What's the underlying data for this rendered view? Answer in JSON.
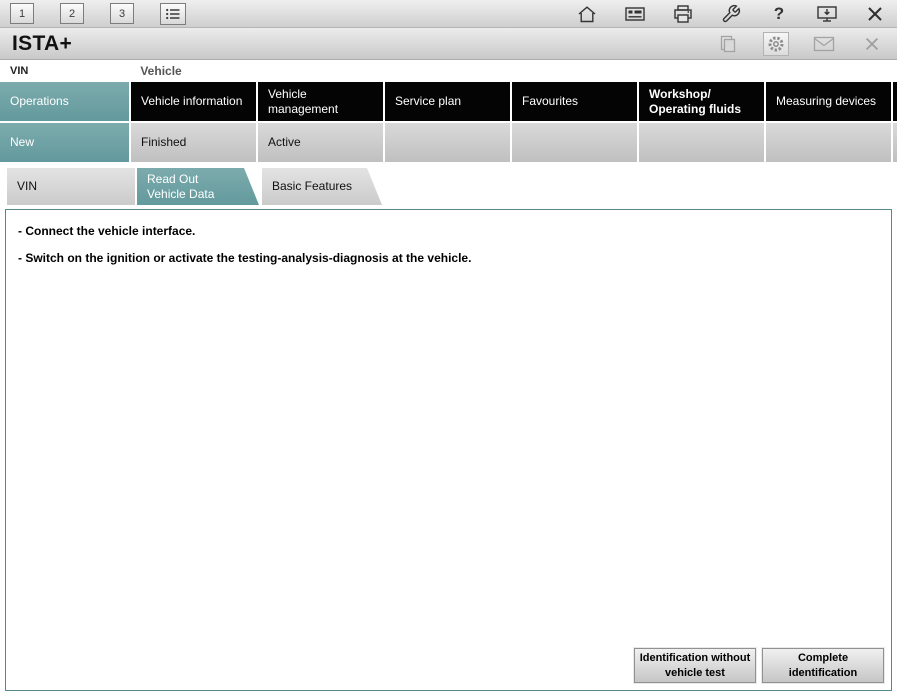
{
  "toolbar": {
    "page_buttons": [
      "1",
      "2",
      "3"
    ],
    "help_glyph": "?"
  },
  "titlebar": {
    "title": "ISTA+"
  },
  "context_bar": {
    "vin_label": "VIN",
    "vehicle_label": "Vehicle"
  },
  "nav_tabs": [
    {
      "label": "Operations",
      "active": true
    },
    {
      "label": "Vehicle information",
      "active": false
    },
    {
      "label": "Vehicle\nmanagement",
      "active": false
    },
    {
      "label": "Service plan",
      "active": false
    },
    {
      "label": "Favourites",
      "active": false
    },
    {
      "label": "Workshop/\nOperating fluids",
      "active": false
    },
    {
      "label": "Measuring devices",
      "active": false
    }
  ],
  "sub_tabs": [
    {
      "label": "New",
      "active": true
    },
    {
      "label": "Finished",
      "active": false
    },
    {
      "label": "Active",
      "active": false
    },
    {
      "label": "",
      "active": false
    },
    {
      "label": "",
      "active": false
    },
    {
      "label": "",
      "active": false
    },
    {
      "label": "",
      "active": false
    }
  ],
  "breadcrumb_tabs": [
    {
      "label": "VIN",
      "active": false
    },
    {
      "label": "Read Out\nVehicle Data",
      "active": true
    },
    {
      "label": "Basic Features",
      "active": false
    }
  ],
  "content": {
    "instructions": [
      "- Connect the vehicle interface.",
      "- Switch on the ignition or activate the testing-analysis-diagnosis at the vehicle."
    ]
  },
  "footer": {
    "buttons": [
      "Identification without vehicle test",
      "Complete identification"
    ]
  },
  "colors": {
    "accent_teal": "#6b9e9f",
    "tab_black": "#040404",
    "content_border": "#54888b"
  },
  "icons": {
    "toolbar_left": [
      "list-icon"
    ],
    "toolbar_right": [
      "home-icon",
      "screen-keyboard-icon",
      "printer-icon",
      "wrench-icon",
      "help-icon",
      "monitor-icon",
      "close-icon"
    ],
    "titlebar_right": [
      "copy-pages-icon",
      "gear-icon",
      "mail-icon",
      "close-icon"
    ]
  }
}
